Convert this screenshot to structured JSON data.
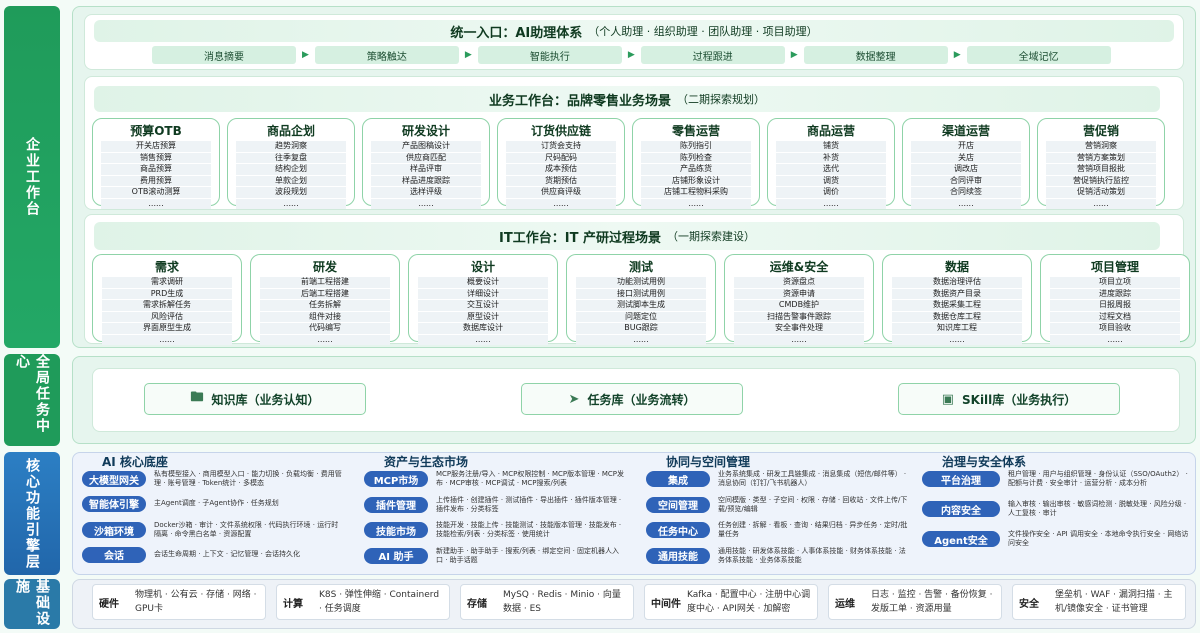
{
  "side": {
    "enterprise": "企业工作台",
    "global": "全局任务中心",
    "core": "核心功能引擎层",
    "infra": "基础设施"
  },
  "ai": {
    "title": "统一入口：AI助理体系",
    "sub": "（个人助理 · 组织助理 · 团队助理 · 项目助理）",
    "chips": [
      "消息摘要",
      "策略触达",
      "智能执行",
      "过程跟进",
      "数据整理",
      "全域记忆"
    ]
  },
  "biz": {
    "title": "业务工作台：品牌零售业务场景",
    "sub": "（二期探索规划）",
    "cols": [
      {
        "h": "预算OTB",
        "items": [
          "开关店预算",
          "销售预算",
          "商品预算",
          "费用预算",
          "OTB滚动测算",
          "......"
        ]
      },
      {
        "h": "商品企划",
        "items": [
          "趋势洞察",
          "往季复盘",
          "结构企划",
          "单款企划",
          "波段规划",
          "......"
        ]
      },
      {
        "h": "研发设计",
        "items": [
          "产品图稿设计",
          "供应商匹配",
          "样品评审",
          "样品进度跟踪",
          "选样评级",
          "......"
        ]
      },
      {
        "h": "订货供应链",
        "items": [
          "订货会支持",
          "尺码配码",
          "成本预估",
          "货期预估",
          "供应商评级",
          "......"
        ]
      },
      {
        "h": "零售运营",
        "items": [
          "陈列指引",
          "陈列检查",
          "产品练货",
          "店铺形象设计",
          "店铺工程物料采购",
          "......"
        ]
      },
      {
        "h": "商品运营",
        "items": [
          "铺货",
          "补货",
          "选代",
          "调货",
          "调价",
          "......"
        ]
      },
      {
        "h": "渠道运营",
        "items": [
          "开店",
          "关店",
          "调改店",
          "合同评审",
          "合同续签",
          "......"
        ]
      },
      {
        "h": "营促销",
        "items": [
          "营销洞察",
          "营销方案策划",
          "营销项目报批",
          "营促销执行监控",
          "促销活动策划",
          "......"
        ]
      }
    ]
  },
  "it": {
    "title": "IT工作台：IT 产研过程场景",
    "sub": "（一期探索建设）",
    "cols": [
      {
        "h": "需求",
        "items": [
          "需求调研",
          "PRD生成",
          "需求拆解任务",
          "风险评估",
          "界面原型生成",
          "......"
        ]
      },
      {
        "h": "研发",
        "items": [
          "前端工程搭建",
          "后端工程搭建",
          "任务拆解",
          "组件对接",
          "代码编写",
          "......"
        ]
      },
      {
        "h": "设计",
        "items": [
          "概要设计",
          "详细设计",
          "交互设计",
          "原型设计",
          "数据库设计",
          "......"
        ]
      },
      {
        "h": "测试",
        "items": [
          "功能测试用例",
          "接口测试用例",
          "测试脚本生成",
          "问题定位",
          "BUG跟踪",
          "......"
        ]
      },
      {
        "h": "运维&安全",
        "items": [
          "资源盘点",
          "资源申请",
          "CMDB维护",
          "扫描告警事件跟踪",
          "安全事件处理",
          "......"
        ]
      },
      {
        "h": "数据",
        "items": [
          "数据治理评估",
          "数据资产目录",
          "数据采集工程",
          "数据仓库工程",
          "知识库工程",
          "......"
        ]
      },
      {
        "h": "项目管理",
        "items": [
          "项目立项",
          "进度跟踪",
          "日报周报",
          "过程文档",
          "项目验收",
          "......"
        ]
      }
    ]
  },
  "libs": [
    "知识库（业务认知）",
    "任务库（业务流转）",
    "SKill库（业务执行）"
  ],
  "core": [
    {
      "title": "AI 核心底座",
      "rows": [
        {
          "btn": "大模型网关",
          "desc": "私有模型接入 · 商用模型入口 · 能力切换 · 负载均衡 · 费用管理 · 账号管理 · Token统计 · 多模态"
        },
        {
          "btn": "智能体引擎",
          "desc": "主Agent调度 · 子Agent协作 · 任务规划"
        },
        {
          "btn": "沙箱环境",
          "desc": "Docker沙箱 · 审计 · 文件系统权限 · 代码执行环境 · 运行时隔离 · 命令黑白名单 · 资源配置"
        },
        {
          "btn": "会话",
          "desc": "会话生命周期 · 上下文 · 记忆管理 · 会话持久化"
        }
      ]
    },
    {
      "title": "资产与生态市场",
      "rows": [
        {
          "btn": "MCP市场",
          "desc": "MCP服务注册/导入 · MCP权限控制 · MCP版本管理 · MCP发布 · MCP审核 · MCP调试 · MCP搜索/列表"
        },
        {
          "btn": "插件管理",
          "desc": "上传插件 · 创建插件 · 测试插件 · 导出插件 · 插件版本管理 · 插件发布 · 分类标签"
        },
        {
          "btn": "技能市场",
          "desc": "技能开发 · 技能上传 · 技能测试 · 技能版本管理 · 技能发布 · 技能检索/列表 · 分类标签 · 使用统计"
        },
        {
          "btn": "AI 助手",
          "desc": "新建助手 · 助手助手 · 搜索/列表 · 绑定空间 · 固定机器人入口 · 助手话题"
        }
      ]
    },
    {
      "title": "协同与空间管理",
      "rows": [
        {
          "btn": "集成",
          "desc": "业务系统集成 · 研发工具链集成 · 消息集成（短信/邮件等） · 消息协同（钉钉/飞书机器人）"
        },
        {
          "btn": "空间管理",
          "desc": "空间模版 · 类型 · 子空间 · 权限 · 存储 · 回收站 · 文件上传/下载/预览/编辑"
        },
        {
          "btn": "任务中心",
          "desc": "任务创建 · 拆解 · 看板 · 查询 · 结果归档 · 异步任务 · 定时/批量任务"
        },
        {
          "btn": "通用技能",
          "desc": "通用技能 · 研发体系技能 · 人事体系技能 · 财务体系技能 · 法务体系技能 · 业务体系技能"
        }
      ]
    },
    {
      "title": "治理与安全体系",
      "rows": [
        {
          "btn": "平台治理",
          "desc": "租户管理 · 用户与组织管理 · 身份认证（SSO/OAuth2） · 配额与计费 · 安全审计 · 运营分析 · 成本分析"
        },
        {
          "btn": "内容安全",
          "desc": "输入审核 · 输出审核 · 敏感词检测 · 脱敏处理 · 风险分级 · 人工复核 · 审计"
        },
        {
          "btn": "Agent安全",
          "desc": "文件操作安全 · API 调用安全 · 本地命令执行安全 · 网络访问安全"
        }
      ]
    }
  ],
  "infra": [
    {
      "k": "硬件",
      "v": "物理机 · 公有云 · 存储 · 网络 · GPU卡"
    },
    {
      "k": "计算",
      "v": "K8S · 弹性伸缩 · Containerd · 任务调度"
    },
    {
      "k": "存储",
      "v": "MySQ · Redis · Minio · 向量数据 · ES"
    },
    {
      "k": "中间件",
      "v": "Kafka · 配置中心 · 注册中心调度中心 · API网关 · 加解密"
    },
    {
      "k": "运维",
      "v": "日志 · 监控 · 告警 · 备份恢复 · 发版工单 · 资源用量"
    },
    {
      "k": "安全",
      "v": "堡垒机 · WAF · 漏洞扫描 · 主机/镜像安全 · 证书管理"
    }
  ]
}
